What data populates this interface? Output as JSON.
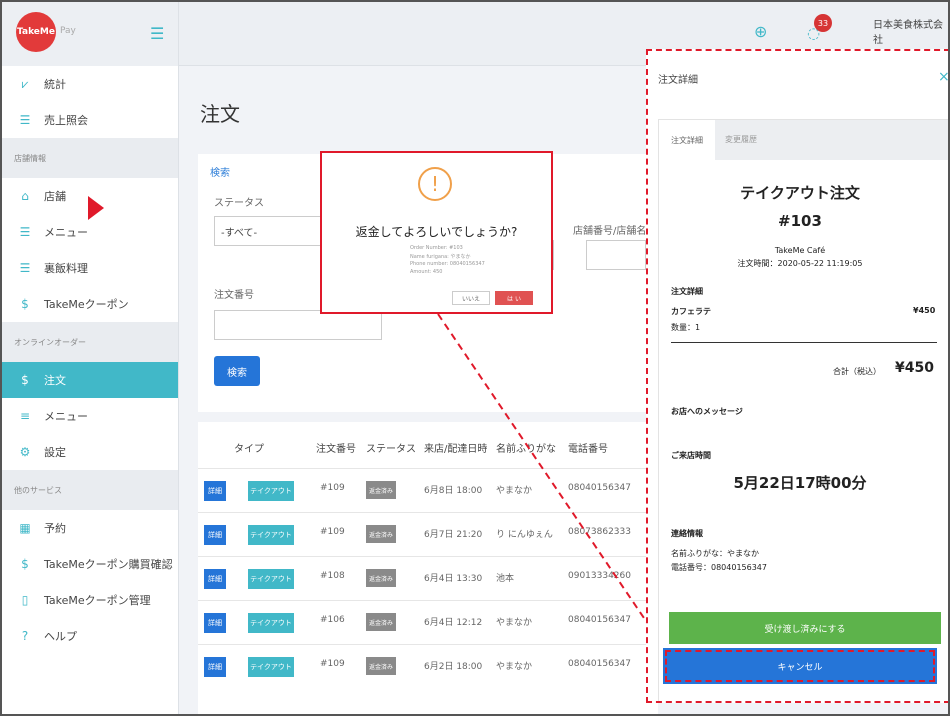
{
  "app": {
    "logo_text": "TakeMe",
    "logo_suffix": "Pay",
    "company": "日本美食株式会社",
    "notification_count": "33"
  },
  "sidebar": {
    "top_items": [
      {
        "label": "統計",
        "icon": "chart-icon"
      },
      {
        "label": "売上照会",
        "icon": "list-icon"
      }
    ],
    "section_store": "店舗情報",
    "store_items": [
      {
        "label": "店舗",
        "icon": "home-icon"
      },
      {
        "label": "メニュー",
        "icon": "list-icon"
      },
      {
        "label": "裏飯料理",
        "icon": "list-icon"
      },
      {
        "label": "TakeMeクーポン",
        "icon": "dollar-icon"
      }
    ],
    "section_online": "オンラインオーダー",
    "online_items": [
      {
        "label": "注文",
        "icon": "dollar-icon",
        "active": true
      },
      {
        "label": "メニュー",
        "icon": "menu-icon"
      },
      {
        "label": "設定",
        "icon": "gear-icon"
      }
    ],
    "section_other": "他のサービス",
    "other_items": [
      {
        "label": "予約",
        "icon": "calendar-icon"
      },
      {
        "label": "TakeMeクーポン購買確認",
        "icon": "dollar-icon"
      },
      {
        "label": "TakeMeクーポン管理",
        "icon": "ticket-icon"
      },
      {
        "label": "ヘルプ",
        "icon": "help-icon"
      }
    ]
  },
  "main": {
    "title": "注文",
    "search": {
      "legend": "検索",
      "status_label": "ステータス",
      "status_value": "-すべて-",
      "order_label": "注文番号",
      "order_value": "",
      "store_label": "店舗番号/店舗名",
      "button": "検索"
    },
    "table": {
      "headers": [
        "タイプ",
        "注文番号",
        "ステータス",
        "来店/配達日時",
        "名前ふりがな",
        "電話番号"
      ],
      "rows": [
        {
          "detail": "詳細",
          "type": "テイクアウト",
          "order": "#109",
          "status": "返金済み",
          "datetime": "6月8日 18:00",
          "name": "やまなか",
          "phone": "08040156347"
        },
        {
          "detail": "詳細",
          "type": "テイクアウト",
          "order": "#109",
          "status": "返金済み",
          "datetime": "6月7日 21:20",
          "name": "り にんゆぇん",
          "phone": "08073862333"
        },
        {
          "detail": "詳細",
          "type": "テイクアウト",
          "order": "#108",
          "status": "返金済み",
          "datetime": "6月4日 13:30",
          "name": "池本",
          "phone": "09013334260"
        },
        {
          "detail": "詳細",
          "type": "テイクアウト",
          "order": "#106",
          "status": "返金済み",
          "datetime": "6月4日 12:12",
          "name": "やまなか",
          "phone": "08040156347"
        },
        {
          "detail": "詳細",
          "type": "テイクアウト",
          "order": "#109",
          "status": "返金済み",
          "datetime": "6月2日 18:00",
          "name": "やまなか",
          "phone": "08040156347"
        }
      ]
    }
  },
  "dialog": {
    "title": "返金してよろしいでしょうか?",
    "lines": [
      "Order Number: #103",
      "Name furigana: やまなか",
      "Phone number: 08040156347",
      "Amount: 450"
    ],
    "cancel_label": "いいえ",
    "confirm_label": "は い"
  },
  "panel": {
    "title": "注文詳細",
    "tab_detail": "注文詳細",
    "tab_history": "変更履歴",
    "order_type": "テイクアウト注文",
    "order_number": "#103",
    "store_name": "TakeMe Café",
    "order_time": "注文時間：2020-05-22 11:19:05",
    "details_heading": "注文詳細",
    "item_name": "カフェラテ",
    "item_price": "¥450",
    "item_qty": "数量：1",
    "total_label": "合計（税込）",
    "total_value": "¥450",
    "message_heading": "お店へのメッセージ",
    "visit_heading": "ご来店時間",
    "visit_time": "5月22日17時00分",
    "contact_heading": "連絡情報",
    "contact_name": "名前ふりがな：やまなか",
    "contact_phone": "電話番号：08040156347",
    "handover_button": "受け渡し済みにする",
    "cancel_button": "キャンセル"
  },
  "colors": {
    "accent": "#41b8c8",
    "primary": "#2575d8",
    "highlight": "#e0192a",
    "success": "#5db34b",
    "brand": "#e23a3a"
  }
}
